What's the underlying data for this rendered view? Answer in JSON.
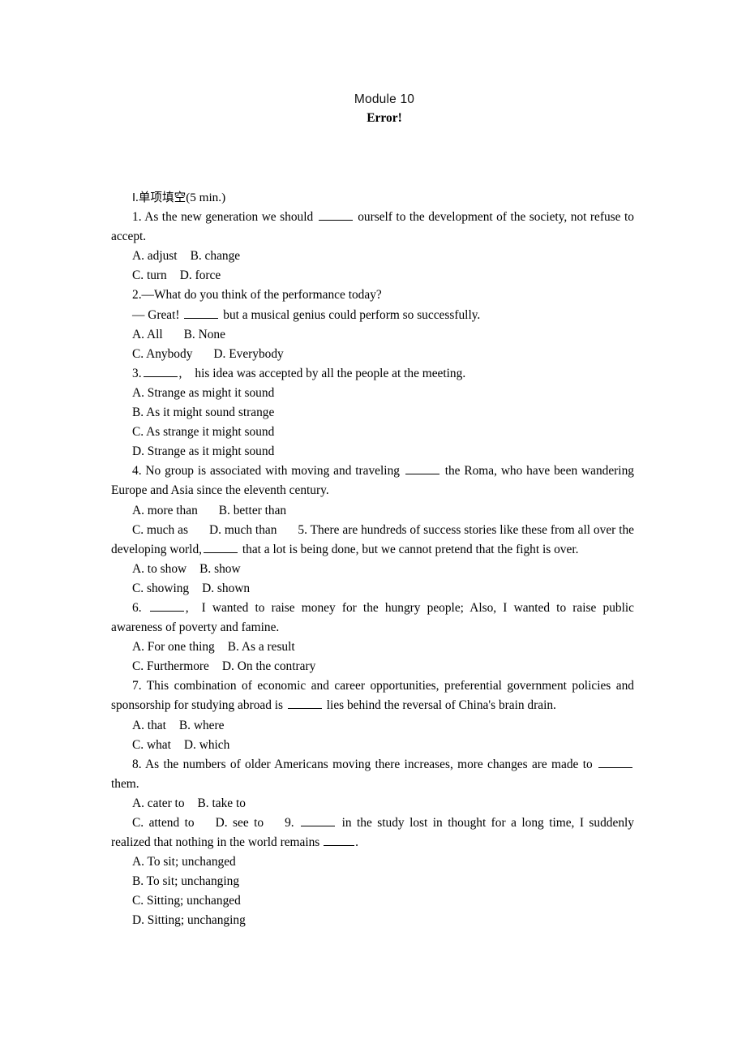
{
  "header": {
    "title": "Module 10",
    "subtitle": "Error!"
  },
  "section": {
    "roman": "Ⅰ",
    "dot": ".",
    "name": "单项填空",
    "time": "(5 min.)"
  },
  "questions": [
    {
      "number": "1.",
      "stem_before": "As the new generation we should",
      "stem_after": "ourself to the development of the society, not refuse to accept.",
      "options_layout": "two-per-line",
      "options": [
        "A. adjust",
        "B. change",
        "C. turn",
        "D. force"
      ]
    },
    {
      "number": "2.",
      "line1": "—What do you think of the performance today?",
      "line2_before": "— Great!",
      "line2_after": "but a musical genius could perform so successfully.",
      "options_layout": "two-per-line",
      "options": [
        "A. All",
        "B. None",
        "C. Anybody",
        "D. Everybody"
      ]
    },
    {
      "number": "3.",
      "stem_before": "",
      "stem_after": ",",
      "stem_tail": "his idea was accepted by all the people at the meeting.",
      "options_layout": "one-per-line",
      "options": [
        "A. Strange as might it sound",
        "B. As it might sound strange",
        "C. As strange it might sound",
        "D. Strange as it might sound"
      ]
    },
    {
      "number": "4.",
      "stem_before": "No group is associated with moving and traveling",
      "stem_after": "the Roma, who have been wandering Europe and Asia since the eleventh century.",
      "options_layout": "two-per-line-flow",
      "options": [
        "A. more than",
        "B. better than",
        "C. much as",
        "D. much than"
      ]
    },
    {
      "number": "5.",
      "stem_before": "There are hundreds of success stories like these from all over the developing world,",
      "stem_after": "that a lot is being done, but we cannot pretend that the fight is over.",
      "options_layout": "two-per-line",
      "options": [
        "A. to show",
        "B. show",
        "C. showing",
        "D. shown"
      ]
    },
    {
      "number": "6.",
      "stem_before": "",
      "stem_after": ",",
      "stem_tail": "I wanted to raise money for the hungry people; Also, I wanted to raise public awareness of poverty and famine.",
      "options_layout": "two-per-line",
      "options": [
        "A. For one thing",
        "B. As a result",
        "C. Furthermore",
        "D. On the contrary"
      ]
    },
    {
      "number": "7.",
      "stem_before": "This combination of economic and career opportunities, preferential government policies and sponsorship for studying abroad is",
      "stem_after": "lies behind the reversal of China's brain drain.",
      "options_layout": "two-per-line",
      "options": [
        "A. that",
        "B. where",
        "C. what",
        "D. which"
      ]
    },
    {
      "number": "8.",
      "stem_before": "As the numbers of older Americans moving there increases, more changes are made to",
      "stem_after": "them.",
      "options_layout": "two-per-line-flow",
      "options": [
        "A. cater to",
        "B. take to",
        "C. attend to",
        "D. see to"
      ]
    },
    {
      "number": "9.",
      "stem_before": "",
      "stem_mid": "in the study lost in thought for a long time, I suddenly realized that nothing in the world remains",
      "stem_after": ".",
      "options_layout": "one-per-line",
      "options": [
        "A. To sit; unchanged",
        "B. To sit; unchanging",
        "C. Sitting; unchanged",
        "D. Sitting; unchanging"
      ]
    }
  ]
}
